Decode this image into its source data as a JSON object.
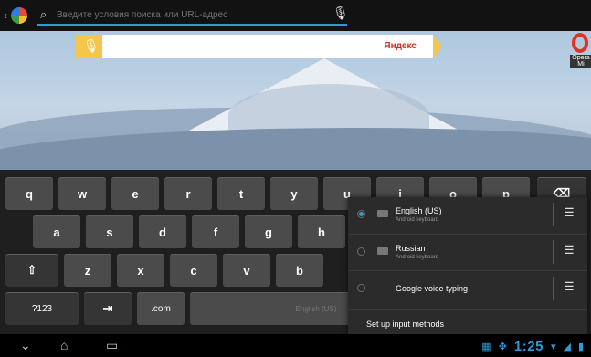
{
  "search": {
    "placeholder": "Введите условия поиска или URL-адрес"
  },
  "yandex": {
    "logo": "Яндекс"
  },
  "opera": {
    "label": "Opera Mi"
  },
  "keyboard": {
    "row1": [
      "q",
      "w",
      "e",
      "r",
      "t",
      "y",
      "u",
      "i",
      "o",
      "p"
    ],
    "row2": [
      "a",
      "s",
      "d",
      "f",
      "g",
      "h"
    ],
    "row3": [
      "z",
      "x",
      "c",
      "v",
      "b"
    ],
    "sym": "?123",
    "dotcom": ".com",
    "space": "English (US)"
  },
  "input_methods": {
    "items": [
      {
        "title": "English (US)",
        "subtitle": "Android keyboard",
        "selected": true
      },
      {
        "title": "Russian",
        "subtitle": "Android keyboard",
        "selected": false
      },
      {
        "title": "Google voice typing",
        "subtitle": "",
        "selected": false
      }
    ],
    "setup_label": "Set up input methods"
  },
  "status": {
    "time": "1:25"
  },
  "colors": {
    "accent": "#2d9ad8",
    "yandex_yellow": "#f6c64a",
    "opera_red": "#e3321e"
  },
  "icons": [
    "back-icon",
    "search-icon",
    "mic-icon",
    "backspace-icon",
    "shift-icon",
    "tab-icon",
    "home-icon",
    "recent-apps-icon",
    "settings-sliders-icon",
    "wifi-icon",
    "signal-icon",
    "battery-icon"
  ]
}
